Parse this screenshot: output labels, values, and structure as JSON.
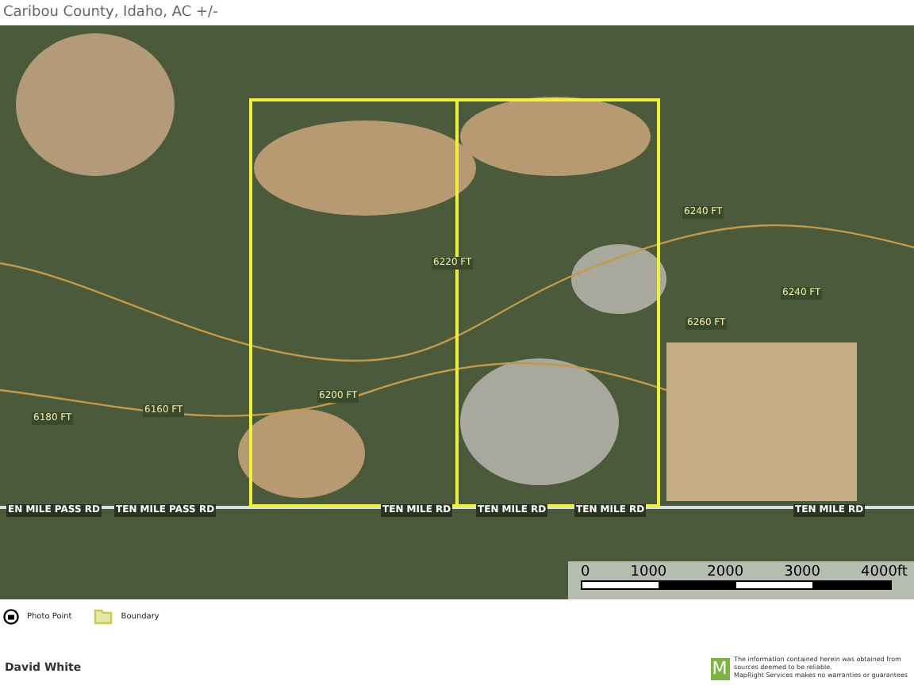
{
  "header": {
    "subtitle": "Caribou County, Idaho,  AC +/-"
  },
  "map": {
    "road_labels": [
      "EN MILE PASS RD",
      "TEN MILE PASS RD",
      "TEN MILE RD",
      "TEN MILE RD",
      "TEN MILE RD",
      "TEN MILE RD"
    ],
    "contour_labels": [
      "6200 FT",
      "6220 FT",
      "6240 FT",
      "6260 FT",
      "6240 FT",
      "6180 FT",
      "6160 FT"
    ],
    "scale": {
      "ticks": [
        "0",
        "1000",
        "2000",
        "3000",
        "4000ft"
      ]
    }
  },
  "legend": [
    {
      "kind": "photo-point",
      "label": "Photo Point"
    },
    {
      "kind": "boundary",
      "label": "Boundary"
    }
  ],
  "footer": {
    "name": "David White",
    "disclaimer": [
      "The information contained herein was obtained from",
      "sources deemed to be reliable.",
      "MapRight Services makes no warranties or guarantees"
    ],
    "logo": "M"
  }
}
